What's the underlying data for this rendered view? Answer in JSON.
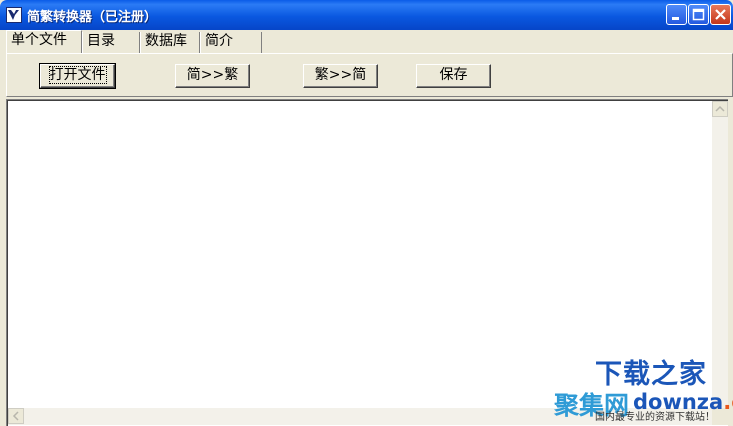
{
  "window": {
    "title": "简繁转换器（已注册）",
    "icon": "v-logo-icon",
    "controls": [
      "minimize-icon",
      "maximize-icon",
      "close-icon"
    ]
  },
  "tabs": [
    {
      "label": "单个文件",
      "active": true
    },
    {
      "label": "目录",
      "active": false
    },
    {
      "label": "数据库",
      "active": false
    },
    {
      "label": "简介",
      "active": false
    }
  ],
  "toolbar": {
    "open_label": "打开文件",
    "s2t_label": "简>>繁",
    "t2s_label": "繁>>简",
    "save_label": "保存"
  },
  "editor": {
    "value": ""
  },
  "watermark": {
    "main": "下载之家",
    "logo": "聚集网",
    "url": "downza",
    "url_tail": ".cn",
    "slogan": "国内最专业的资源下载站！"
  },
  "colors": {
    "titlebar": "#0a58e0",
    "face": "#ece9d8",
    "close_button": "#c4361a",
    "watermark_blue": "#1b56b8",
    "watermark_orange": "#e8571b"
  }
}
